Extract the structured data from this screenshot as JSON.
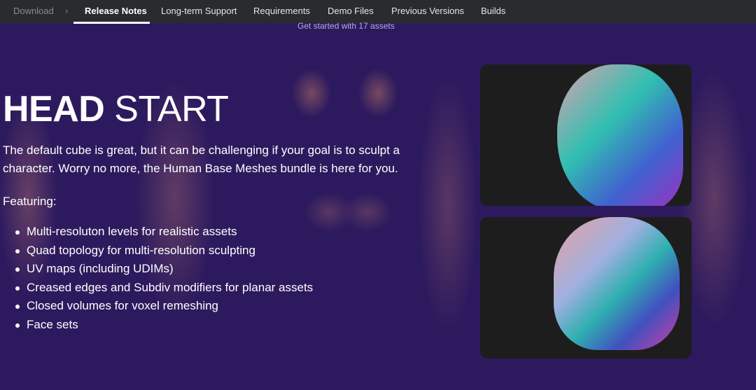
{
  "nav": {
    "breadcrumb": "Download",
    "separator": "›",
    "tabs": [
      {
        "label": "Release Notes",
        "active": true
      },
      {
        "label": "Long-term Support"
      },
      {
        "label": "Requirements"
      },
      {
        "label": "Demo Files"
      },
      {
        "label": "Previous Versions"
      },
      {
        "label": "Builds"
      }
    ]
  },
  "hero": {
    "subtitle": "Get started with 17 assets",
    "title_bold": "HEAD",
    "title_rest": " START",
    "description": "The default cube is great, but it can be challenging if your goal is to sculpt a character. Worry no more, the Human Base Meshes bundle is here for you.",
    "featuring": "Featuring:",
    "features": [
      "Multi-resoluton levels for realistic assets",
      "Quad topology for multi-resolution sculpting",
      "UV maps (including UDIMs)",
      "Creased edges and Subdiv modifiers for planar assets",
      "Closed volumes for voxel remeshing",
      "Face sets"
    ]
  },
  "colors": {
    "nav_bg": "#2a2b2e",
    "hero_bg": "#2d1a5e",
    "panel_bg": "#1d1d1d"
  }
}
